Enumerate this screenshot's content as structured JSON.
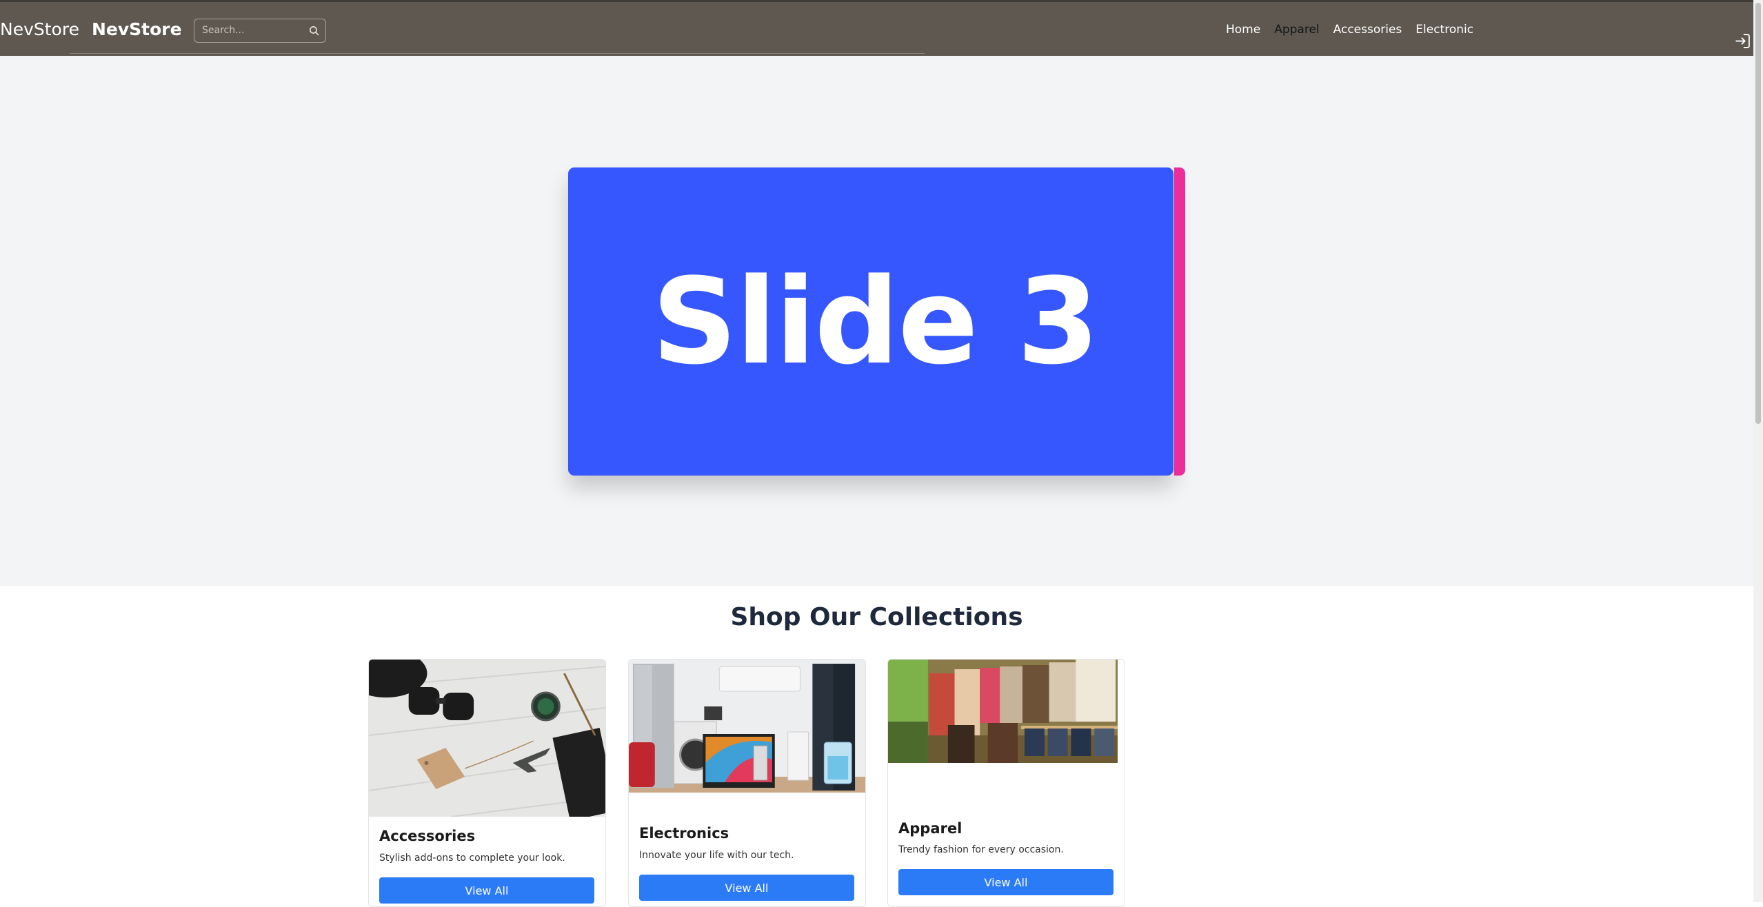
{
  "header": {
    "brand_plain": "NevStore",
    "brand_bold": "NevStore",
    "search": {
      "placeholder": "Search..."
    },
    "nav_links": [
      "Home",
      "Apparel",
      "Accessories",
      "Electronic"
    ],
    "active_link": "Apparel"
  },
  "hero": {
    "slide_label": "Slide 3",
    "slide_color": "#3557fd",
    "next_slide_color": "#ec2e9b"
  },
  "collections": {
    "title": "Shop Our Collections",
    "cards": [
      {
        "title": "Accessories",
        "description": "Stylish add-ons to complete your look.",
        "button": "View All"
      },
      {
        "title": "Electronics",
        "description": "Innovate your life with our tech.",
        "button": "View All"
      },
      {
        "title": "Apparel",
        "description": "Trendy fashion for every occasion.",
        "button": "View All"
      }
    ]
  },
  "colors": {
    "navbar": "#5e5850",
    "accent_button": "#2c7bf6",
    "hero_bg": "#f3f4f6"
  },
  "icons": {
    "search": "search-icon",
    "login": "login-icon"
  }
}
